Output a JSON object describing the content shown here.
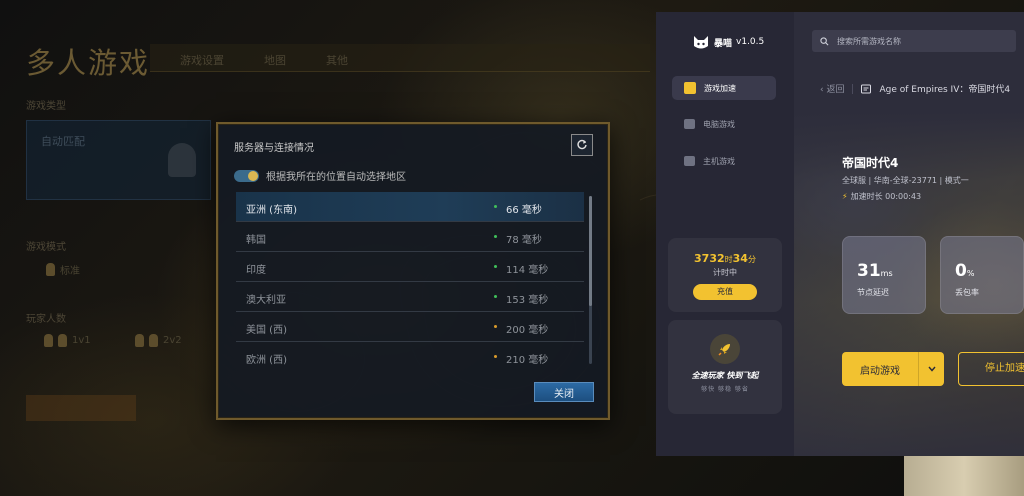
{
  "game": {
    "title": "多人游戏",
    "tabs": [
      "游戏设置",
      "地图",
      "其他"
    ],
    "labels": {
      "game_type": "游戏类型",
      "game_mode": "游戏模式",
      "player_count": "玩家人数"
    },
    "type_option": "自动匹配",
    "mode_option": "标准",
    "player_options": [
      "1v1",
      "2v2"
    ]
  },
  "server_dialog": {
    "title": "服务器与连接情况",
    "auto_region_label": "根据我所在的位置自动选择地区",
    "servers": [
      {
        "name": "亚洲 (东南)",
        "ping": "66 毫秒",
        "status_color": "#3fbf5a"
      },
      {
        "name": "韩国",
        "ping": "78 毫秒",
        "status_color": "#3fbf5a"
      },
      {
        "name": "印度",
        "ping": "114 毫秒",
        "status_color": "#3fbf5a"
      },
      {
        "name": "澳大利亚",
        "ping": "153 毫秒",
        "status_color": "#3fbf5a"
      },
      {
        "name": "美国 (西)",
        "ping": "200 毫秒",
        "status_color": "#d99a2b"
      },
      {
        "name": "欧洲 (西)",
        "ping": "210 毫秒",
        "status_color": "#d99a2b"
      }
    ],
    "close_label": "关闭"
  },
  "accelerator": {
    "app_name": "暴喵",
    "version": "v1.0.5",
    "nav": [
      {
        "label": "游戏加速",
        "icon": "rocket-icon"
      },
      {
        "label": "电脑游戏",
        "icon": "monitor-icon"
      },
      {
        "label": "主机游戏",
        "icon": "console-icon"
      }
    ],
    "timer": {
      "hours": "3732",
      "hours_unit": "时",
      "minutes": "34",
      "minutes_unit": "分",
      "label": "计时中"
    },
    "recharge_label": "充值",
    "promo": {
      "title": "全速玩家 快到飞起",
      "subtitle": "够快 够稳 够省"
    },
    "search_placeholder": "搜索所需游戏名称",
    "back_label": "返回",
    "breadcrumb_game": "Age of Empires IV：帝国时代4",
    "game_name": "帝国时代4",
    "game_meta": "全球服 | 华南-全球-23771 | 模式一",
    "duration_label": "加速时长 00:00:43",
    "stats": [
      {
        "value": "31",
        "unit": "ms",
        "label": "节点延迟"
      },
      {
        "value": "0",
        "unit": "%",
        "label": "丢包率"
      }
    ],
    "launch_label": "启动游戏",
    "stop_label": "停止加速",
    "accent_color": "#f2c230"
  }
}
